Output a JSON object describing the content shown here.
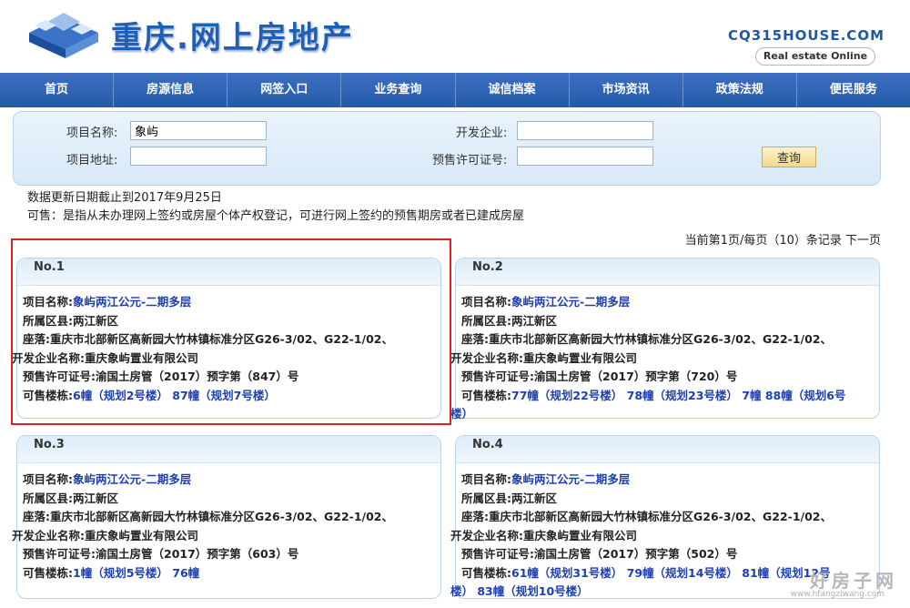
{
  "header": {
    "title": "重庆.网上房地产",
    "brand": "CQ315HOUSE.COM",
    "brand_sub": "Real estate Online"
  },
  "nav": [
    "首页",
    "房源信息",
    "网签入口",
    "业务查询",
    "诚信档案",
    "市场资讯",
    "政策法规",
    "便民服务"
  ],
  "search": {
    "project_name_label": "项目名称:",
    "project_name_value": "象屿",
    "project_addr_label": "项目地址:",
    "project_addr_value": "",
    "developer_label": "开发企业:",
    "developer_value": "",
    "permit_label": "预售许可证号:",
    "permit_value": "",
    "query_button": "查询"
  },
  "notes": {
    "update": "数据更新日期截止到2017年9月25日",
    "definition": "可售：是指从未办理网上签约或房屋个体产权登记，可进行网上签约的预售期房或者已建成房屋"
  },
  "pager": "当前第1页/每页（10）条记录 下一页",
  "labels": {
    "name": "项目名称:",
    "district": "所属区县:",
    "location_a": "座落:",
    "location_b": "重庆市北部新区高新园大竹林镇标准分区G26-3/02、G22-1/02、",
    "developer": "开发企业名称:",
    "permit": "预售许可证号:",
    "buildings": "可售楼栋:"
  },
  "cards": [
    {
      "no": "No.1",
      "name": "象屿两江公元-二期多层",
      "district": "两江新区",
      "developer": "重庆象屿置业有限公司",
      "permit": "渝国土房管（2017）预字第（847）号",
      "buildings": "6幢（规划2号楼） 87幢（规划7号楼）",
      "buildings_2": ""
    },
    {
      "no": "No.2",
      "name": "象屿两江公元-二期多层",
      "district": "两江新区",
      "developer": "重庆象屿置业有限公司",
      "permit": "渝国土房管（2017）预字第（720）号",
      "buildings": "77幢（规划22号楼） 78幢（规划23号楼） 7幢 88幢（规划6号",
      "buildings_2": "楼）"
    },
    {
      "no": "No.3",
      "name": "象屿两江公元-二期多层",
      "district": "两江新区",
      "developer": "重庆象屿置业有限公司",
      "permit": "渝国土房管（2017）预字第（603）号",
      "buildings": "1幢（规划5号楼） 76幢",
      "buildings_2": ""
    },
    {
      "no": "No.4",
      "name": "象屿两江公元-二期多层",
      "district": "两江新区",
      "developer": "重庆象屿置业有限公司",
      "permit": "渝国土房管（2017）预字第（502）号",
      "buildings": "61幢（规划31号楼） 79幢（规划14号楼） 81幢（规划12号",
      "buildings_2": "楼） 83幢（规划10号楼）"
    }
  ],
  "watermark": "好房子网",
  "watermark_url": "www.hfangziwang.com",
  "colors": {
    "nav_bg": "#2d63b3",
    "link": "#1c3fb1",
    "highlight": "#e02020"
  }
}
